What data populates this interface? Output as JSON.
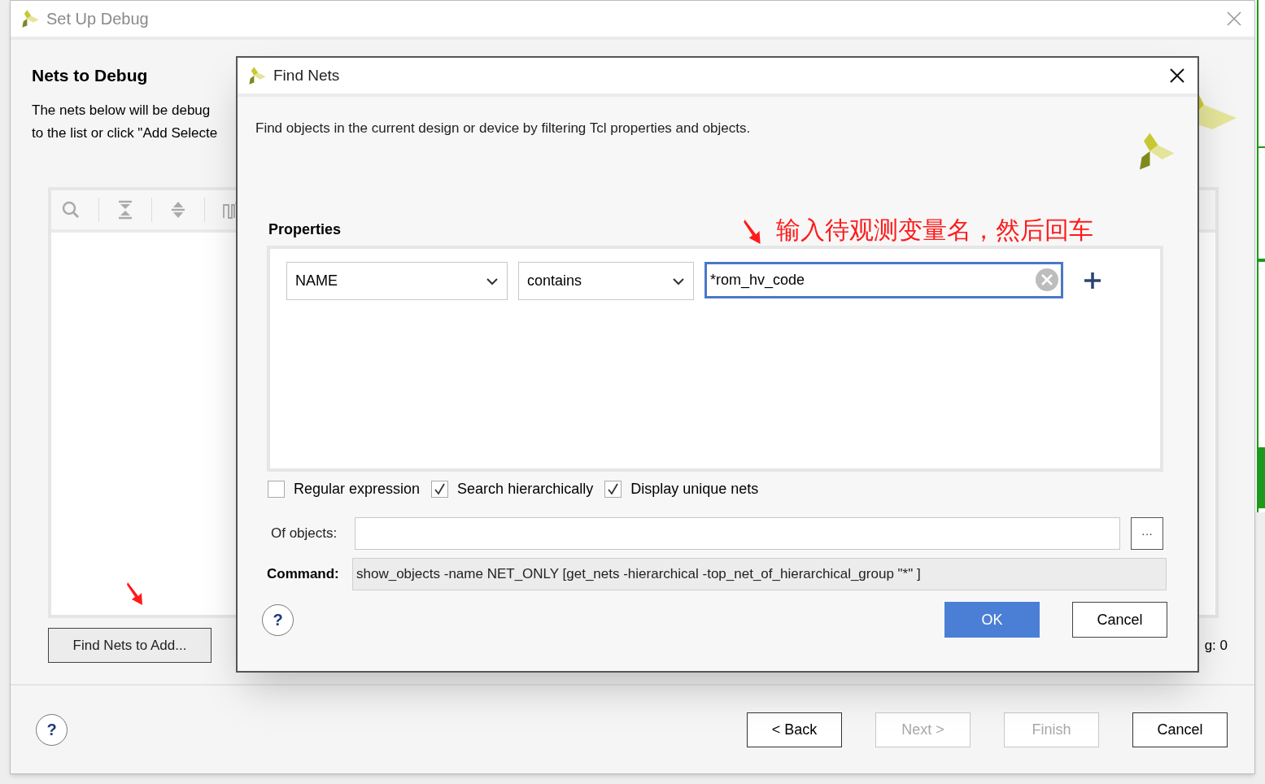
{
  "wizard": {
    "title": "Set Up Debug",
    "heading": "Nets to Debug",
    "description_lines": [
      "The nets below will be debug",
      "to the list or click \"Add Selecte"
    ],
    "find_button": "Find Nets to Add...",
    "count_text": "g: 0",
    "help": "?",
    "buttons": [
      {
        "label": "< Back",
        "disabled": false
      },
      {
        "label": "Next >",
        "disabled": true
      },
      {
        "label": "Finish",
        "disabled": true
      },
      {
        "label": "Cancel",
        "disabled": false
      }
    ]
  },
  "dialog": {
    "title": "Find Nets",
    "description": "Find objects in the current design or device by filtering Tcl properties and objects.",
    "properties_label": "Properties",
    "filter": {
      "property": "NAME",
      "operator": "contains",
      "value": "*rom_hv_code"
    },
    "options": [
      {
        "label": "Regular expression",
        "checked": false
      },
      {
        "label": "Search hierarchically",
        "checked": true
      },
      {
        "label": "Display unique nets",
        "checked": true
      }
    ],
    "of_objects_label": "Of objects:",
    "browse_button": "···",
    "command_label": "Command:",
    "command": "show_objects -name NET_ONLY [get_nets -hierarchical -top_net_of_hierarchical_group \"*\" ]",
    "help": "?",
    "buttons": [
      {
        "label": "OK",
        "kind": "primary"
      },
      {
        "label": "Cancel",
        "kind": "secondary"
      }
    ]
  },
  "annotation": {
    "text": "输入待观测变量名，然后回车"
  }
}
